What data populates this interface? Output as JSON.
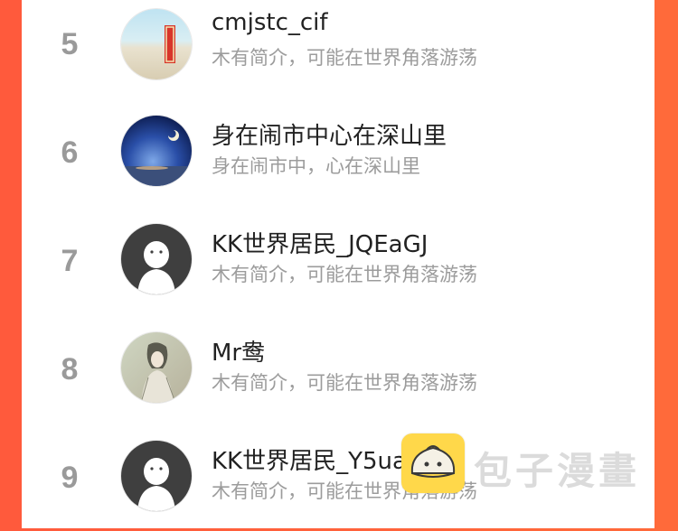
{
  "users": [
    {
      "rank": "5",
      "name": "cmjstc_cif",
      "bio": "木有简介，可能在世界角落游荡",
      "avatar": "beach-photo"
    },
    {
      "rank": "6",
      "name": "身在闹市中心在深山里",
      "bio": "身在闹市中，心在深山里",
      "avatar": "night-sky-photo"
    },
    {
      "rank": "7",
      "name": "KK世界居民_JQEaGJ",
      "bio": "木有简介，可能在世界角落游荡",
      "avatar": "default-avatar"
    },
    {
      "rank": "8",
      "name": "Mr鸯",
      "bio": "木有简介，可能在世界角落游荡",
      "avatar": "illustration-photo"
    },
    {
      "rank": "9",
      "name": "KK世界居民_Y5uaPK",
      "bio": "木有简介，可能在世界角落游荡",
      "avatar": "default-avatar"
    }
  ],
  "watermark": {
    "text": "包子漫畫"
  },
  "colors": {
    "background": "#ff5a3c",
    "rank": "#9a9a9a",
    "name": "#222222",
    "bio": "#9c9c9c"
  }
}
